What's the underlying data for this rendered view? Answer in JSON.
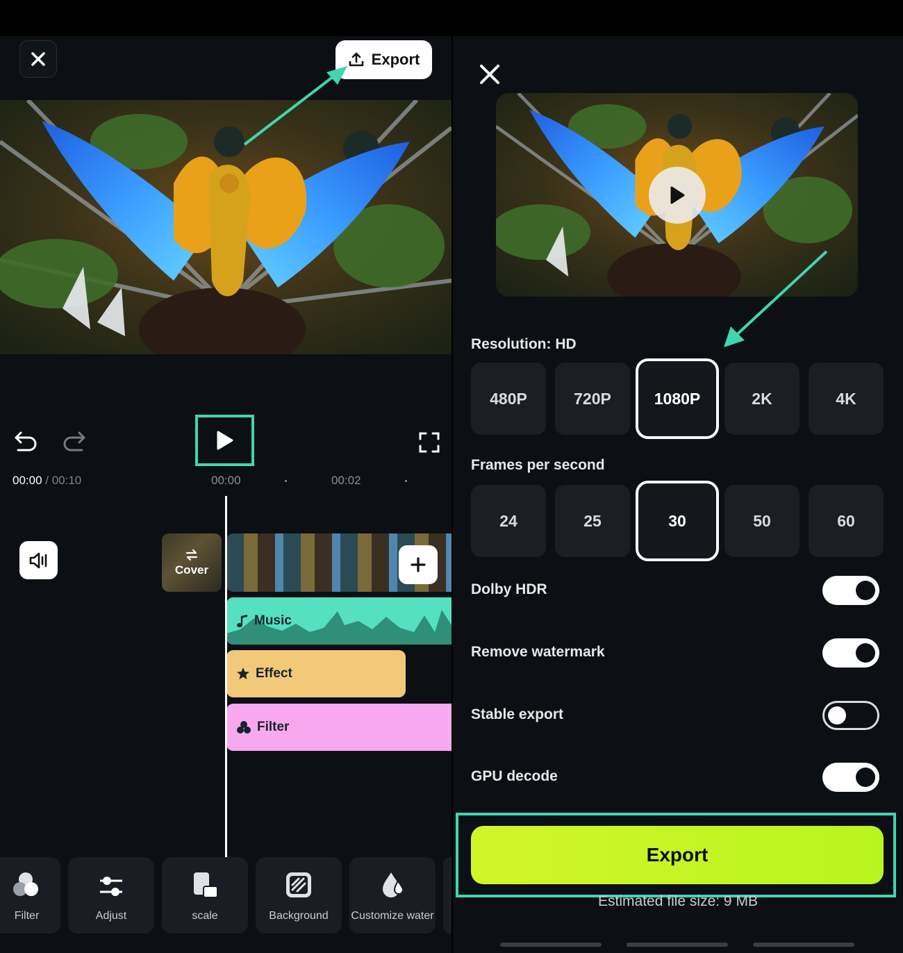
{
  "left": {
    "export_label": "Export",
    "time": {
      "current": "00:00",
      "separator": " / ",
      "total": "00:10",
      "mark1": "00:00",
      "mark2": "00:02"
    },
    "cover_label": "Cover",
    "tracks": {
      "music": "Music",
      "effect": "Effect",
      "filter": "Filter"
    },
    "tools": [
      {
        "label": "Filter",
        "icon": "filter-icon"
      },
      {
        "label": "Adjust",
        "icon": "adjust-icon"
      },
      {
        "label": "scale",
        "icon": "scale-icon"
      },
      {
        "label": "Background",
        "icon": "background-icon"
      },
      {
        "label": "Customize water",
        "icon": "watermark-icon"
      }
    ]
  },
  "right": {
    "resolution_label": "Resolution: HD",
    "resolutions": [
      "480P",
      "720P",
      "1080P",
      "2K",
      "4K"
    ],
    "resolution_selected": "1080P",
    "fps_label": "Frames per second",
    "fps": [
      "24",
      "25",
      "30",
      "50",
      "60"
    ],
    "fps_selected": "30",
    "toggles": [
      {
        "label": "Dolby HDR",
        "on": true
      },
      {
        "label": "Remove watermark",
        "on": true
      },
      {
        "label": "Stable export",
        "on": false
      },
      {
        "label": "GPU decode",
        "on": true
      }
    ],
    "export_label": "Export",
    "estimate": "Estimated file size: 9 MB"
  },
  "colors": {
    "accent": "#3fd6b1",
    "export_button": "#c6f524",
    "music": "#55e0c0",
    "effect": "#f2c879",
    "filter": "#f8a8ef"
  }
}
